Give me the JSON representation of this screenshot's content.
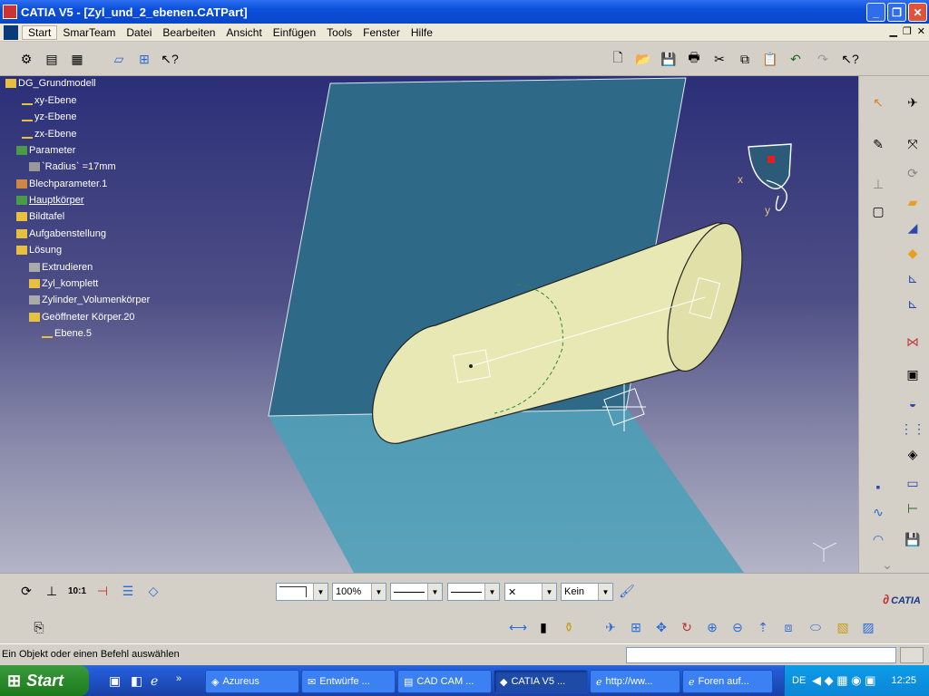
{
  "window": {
    "title": "CATIA V5 - [Zyl_und_2_ebenen.CATPart]",
    "minimize": "_",
    "maximize": "❐",
    "close": "✕"
  },
  "menu": {
    "items": [
      "Start",
      "SmarTeam",
      "Datei",
      "Bearbeiten",
      "Ansicht",
      "Einfügen",
      "Tools",
      "Fenster",
      "Hilfe"
    ],
    "selected": "Start"
  },
  "tree": {
    "root": "DG_Grundmodell",
    "nodes": [
      {
        "label": "xy-Ebene"
      },
      {
        "label": "yz-Ebene"
      },
      {
        "label": "zx-Ebene"
      },
      {
        "label": "Parameter"
      },
      {
        "label": "`Radius` =17mm"
      },
      {
        "label": "Blechparameter.1"
      },
      {
        "label": "Hauptkörper"
      },
      {
        "label": "Bildtafel"
      },
      {
        "label": "Aufgabenstellung"
      },
      {
        "label": "Lösung"
      },
      {
        "label": "Extrudieren"
      },
      {
        "label": "Zyl_komplett"
      },
      {
        "label": "Zylinder_Volumenkörper"
      },
      {
        "label": "Geöffneter Körper.20"
      },
      {
        "label": "Ebene.5"
      }
    ]
  },
  "compass": {
    "x_label": "x",
    "y_label": "y"
  },
  "properties": {
    "zoom": "100%",
    "layer": "Kein"
  },
  "status": {
    "message": "Ein Objekt oder einen Befehl auswählen"
  },
  "brand": {
    "logo_text": "CATIA"
  },
  "taskbar": {
    "start_label": "Start",
    "tasks": [
      "Azureus",
      "Entwürfe ...",
      "CAD CAM ...",
      "CATIA V5 ...",
      "http://ww...",
      "Foren auf..."
    ],
    "active_task": "CATIA V5 ...",
    "language": "DE",
    "clock": "12:25"
  },
  "colors": {
    "title_bar": "#0a4fd8",
    "viewport_top": "#2b2f78",
    "viewport_bottom": "#b3b4c6",
    "cylinder": "#e8e8b4",
    "plane": "#2e6a88"
  }
}
